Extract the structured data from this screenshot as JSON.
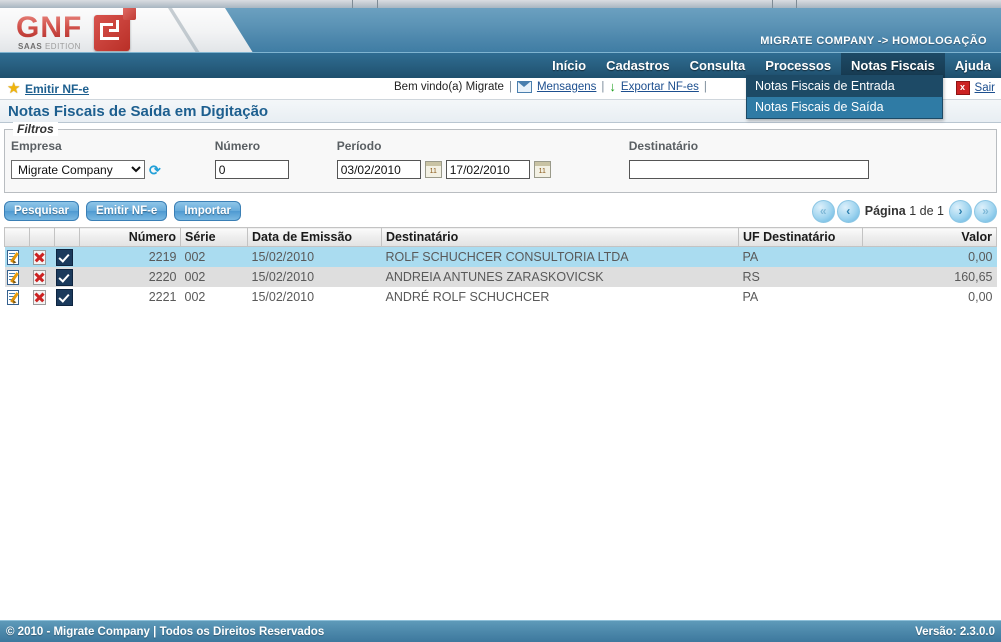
{
  "header": {
    "logo_text": "GNF",
    "logo_sub_bold": "SAAS",
    "logo_sub_rest": " EDITION",
    "company_context": "MIGRATE COMPANY -> HOMOLOGAÇÃO"
  },
  "menu": {
    "items": [
      {
        "label": "Início",
        "active": false
      },
      {
        "label": "Cadastros",
        "active": false
      },
      {
        "label": "Consulta",
        "active": false
      },
      {
        "label": "Processos",
        "active": false
      },
      {
        "label": "Notas Fiscais",
        "active": true
      },
      {
        "label": "Ajuda",
        "active": false
      }
    ]
  },
  "dropdown": {
    "items": [
      {
        "label": "Notas Fiscais de Entrada",
        "state": "hover"
      },
      {
        "label": "Notas Fiscais de Saída",
        "state": "normal"
      }
    ]
  },
  "utilbar": {
    "emitir_link": "Emitir NF-e",
    "welcome": "Bem vindo(a) Migrate",
    "sep": "|",
    "mensagens": "Mensagens",
    "exportar": "Exportar NF-es",
    "sair": "Sair"
  },
  "page": {
    "title": "Notas Fiscais de Saída em Digitação"
  },
  "filters": {
    "legend": "Filtros",
    "empresa_label": "Empresa",
    "empresa_value": "Migrate Company",
    "empresa_options": [
      "Migrate Company"
    ],
    "numero_label": "Número",
    "numero_value": "0",
    "periodo_label": "Período",
    "periodo_from": "03/02/2010",
    "periodo_to": "17/02/2010",
    "destinatario_label": "Destinatário",
    "destinatario_value": ""
  },
  "actions": {
    "pesquisar": "Pesquisar",
    "emitir": "Emitir NF-e",
    "importar": "Importar"
  },
  "pager": {
    "first": "«",
    "prev": "‹",
    "label": "Página",
    "current": "1",
    "of": "de",
    "total": "1",
    "next": "›",
    "last": "»"
  },
  "table": {
    "columns": [
      {
        "key": "edit",
        "label": "",
        "align": "left"
      },
      {
        "key": "delete",
        "label": "",
        "align": "left"
      },
      {
        "key": "check",
        "label": "",
        "align": "left"
      },
      {
        "key": "numero",
        "label": "Número",
        "align": "right"
      },
      {
        "key": "serie",
        "label": "Série",
        "align": "left"
      },
      {
        "key": "data",
        "label": "Data de Emissão",
        "align": "left"
      },
      {
        "key": "dest",
        "label": "Destinatário",
        "align": "left"
      },
      {
        "key": "uf",
        "label": "UF Destinatário",
        "align": "left"
      },
      {
        "key": "valor",
        "label": "Valor",
        "align": "right"
      }
    ],
    "rows": [
      {
        "numero": "2219",
        "serie": "002",
        "data": "15/02/2010",
        "dest": "ROLF SCHUCHCER CONSULTORIA LTDA",
        "uf": "PA",
        "valor": "0,00",
        "style": "r-sel"
      },
      {
        "numero": "2220",
        "serie": "002",
        "data": "15/02/2010",
        "dest": "ANDREIA ANTUNES ZARASKOVICSK",
        "uf": "RS",
        "valor": "160,65",
        "style": "r-alt"
      },
      {
        "numero": "2221",
        "serie": "002",
        "data": "15/02/2010",
        "dest": "ANDRÉ ROLF SCHUCHCER",
        "uf": "PA",
        "valor": "0,00",
        "style": "r-pln"
      }
    ]
  },
  "footer": {
    "copyright": "© 2010 - Migrate Company | Todos os Direitos Reservados",
    "version": "Versão: 2.3.0.0"
  },
  "colors": {
    "header_blue": "#4d87ac",
    "menu_blue": "#285f80",
    "active_menu": "#1d4a66",
    "link_blue": "#1d5f8f",
    "row_selected": "#aadcf0",
    "row_alt": "#dedede",
    "accent_red": "#b92f27",
    "footer_blue": "#4e8aac"
  }
}
